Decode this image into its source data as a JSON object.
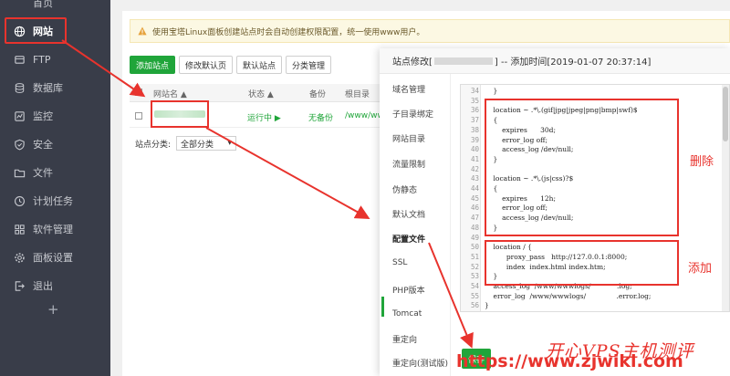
{
  "sidebar": {
    "top_label": "首页",
    "items": [
      {
        "label": "网站",
        "icon": "globe-icon"
      },
      {
        "label": "FTP",
        "icon": "ftp-icon"
      },
      {
        "label": "数据库",
        "icon": "database-icon"
      },
      {
        "label": "监控",
        "icon": "monitor-icon"
      },
      {
        "label": "安全",
        "icon": "shield-icon"
      },
      {
        "label": "文件",
        "icon": "folder-icon"
      },
      {
        "label": "计划任务",
        "icon": "clock-icon"
      },
      {
        "label": "软件管理",
        "icon": "grid-icon"
      },
      {
        "label": "面板设置",
        "icon": "gear-icon"
      },
      {
        "label": "退出",
        "icon": "logout-icon"
      }
    ],
    "plus": "+"
  },
  "notice": "使用宝塔Linux面板创建站点时会自动创建权限配置，统一使用www用户。",
  "toolbar": {
    "add_site": "添加站点",
    "edit_default_page": "修改默认页",
    "default_site": "默认站点",
    "category_manage": "分类管理"
  },
  "table": {
    "headers": [
      "网站名 ▲",
      "状态 ▲",
      "备份",
      "根目录"
    ],
    "row": {
      "status": "运行中 ▶",
      "backup": "无备份",
      "root": "/www/wwv"
    }
  },
  "filter": {
    "label": "站点分类:",
    "value": "全部分类",
    "caret": "▾"
  },
  "modal": {
    "title_prefix": "站点修改[",
    "title_suffix": "] -- 添加时间[2019-01-07 20:37:14]",
    "nav": [
      "域名管理",
      "子目录绑定",
      "网站目录",
      "流量限制",
      "伪静态",
      "默认文档",
      "配置文件",
      "SSL",
      "PHP版本",
      "Tomcat",
      "重定向",
      "重定向(测试版)"
    ],
    "active_nav": "配置文件",
    "save_label": "保存"
  },
  "code_lines": [
    {
      "n": "34",
      "t": "    }"
    },
    {
      "n": "35",
      "t": ""
    },
    {
      "n": "36",
      "t": "    location ~ .*\\.(gif|jpg|jpeg|png|bmp|swf)$"
    },
    {
      "n": "37",
      "t": "    {"
    },
    {
      "n": "38",
      "t": "        expires      30d;"
    },
    {
      "n": "39",
      "t": "        error_log off;"
    },
    {
      "n": "40",
      "t": "        access_log /dev/null;"
    },
    {
      "n": "41",
      "t": "    }"
    },
    {
      "n": "42",
      "t": ""
    },
    {
      "n": "43",
      "t": "    location ~ .*\\.(js|css)?$"
    },
    {
      "n": "44",
      "t": "    {"
    },
    {
      "n": "45",
      "t": "        expires      12h;"
    },
    {
      "n": "46",
      "t": "        error_log off;"
    },
    {
      "n": "47",
      "t": "        access_log /dev/null;"
    },
    {
      "n": "48",
      "t": "    }"
    },
    {
      "n": "49",
      "t": ""
    },
    {
      "n": "50",
      "t": "    location / {"
    },
    {
      "n": "51",
      "t": "          proxy_pass   http://127.0.0.1:8000;"
    },
    {
      "n": "52",
      "t": "          index  index.html index.htm;"
    },
    {
      "n": "53",
      "t": "    }"
    },
    {
      "n": "54",
      "t": "    access_log  /www/wwwlogs/            .log;"
    },
    {
      "n": "55",
      "t": "    error_log  /www/wwwlogs/              .error.log;"
    },
    {
      "n": "56",
      "t": "}"
    }
  ],
  "annotations": {
    "delete": "删除",
    "add": "添加"
  },
  "watermark": {
    "line1": "开心VPS主机测评",
    "line2": "https://www.zjwiki.com"
  },
  "colors": {
    "red": "#e8332d",
    "green": "#20a53a",
    "sidebar": "#393d49"
  }
}
